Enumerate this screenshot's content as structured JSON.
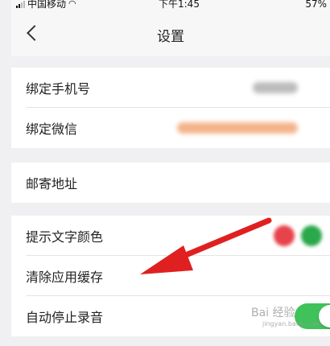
{
  "status_bar": {
    "carrier": "中国移动",
    "time": "下午1:45",
    "battery": "57%"
  },
  "nav": {
    "title": "设置"
  },
  "groups": [
    {
      "items": [
        {
          "label": "绑定手机号",
          "value_hint": "blurred-text"
        },
        {
          "label": "绑定微信",
          "value_hint": "blurred-orange-text"
        }
      ]
    },
    {
      "items": [
        {
          "label": "邮寄地址"
        }
      ]
    },
    {
      "items": [
        {
          "label": "提示文字颜色"
        },
        {
          "label": "清除应用缓存"
        },
        {
          "label": "自动停止录音"
        }
      ]
    }
  ],
  "annotation": {
    "arrow_color": "#e02020"
  },
  "toggle": {
    "auto_stop_recording": true,
    "color": "#3fc25a"
  },
  "colors": {
    "accent_red": "#e8424a",
    "accent_green": "#2aa84a"
  },
  "watermark": {
    "text": "Bai 经验",
    "sub": "jingyan.baidu.com"
  }
}
